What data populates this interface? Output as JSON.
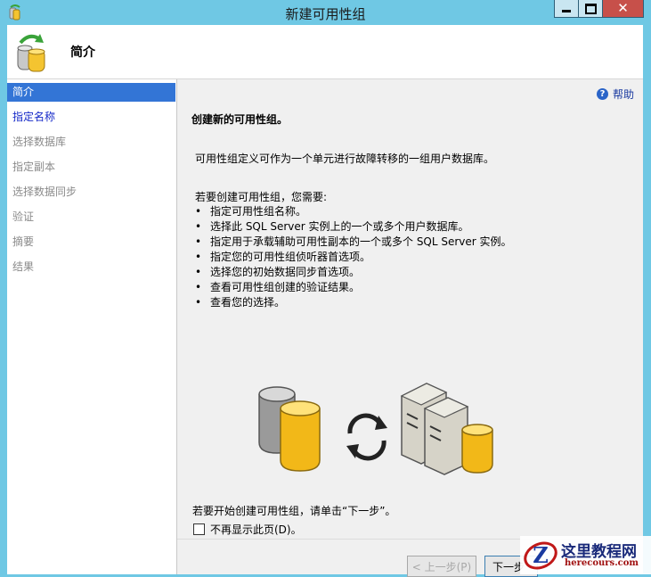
{
  "window": {
    "title": "新建可用性组"
  },
  "header": {
    "title": "简介"
  },
  "nav": {
    "items": [
      {
        "label": "简介",
        "state": "active"
      },
      {
        "label": "指定名称",
        "state": "link"
      },
      {
        "label": "选择数据库",
        "state": "disabled"
      },
      {
        "label": "指定副本",
        "state": "disabled"
      },
      {
        "label": "选择数据同步",
        "state": "disabled"
      },
      {
        "label": "验证",
        "state": "disabled"
      },
      {
        "label": "摘要",
        "state": "disabled"
      },
      {
        "label": "结果",
        "state": "disabled"
      }
    ]
  },
  "content": {
    "help_label": "帮助",
    "heading": "创建新的可用性组。",
    "description": "可用性组定义可作为一个单元进行故障转移的一组用户数据库。",
    "requirements_intro": "若要创建可用性组，您需要:",
    "requirements": [
      "指定可用性组名称。",
      "选择此 SQL Server 实例上的一个或多个用户数据库。",
      "指定用于承载辅助可用性副本的一个或多个 SQL Server 实例。",
      "指定您的可用性组侦听器首选项。",
      "选择您的初始数据同步首选项。",
      "查看可用性组创建的验证结果。",
      "查看您的选择。"
    ],
    "start_text": "若要开始创建可用性组，请单击“下一步”。",
    "dont_show_label": "不再显示此页(D)。",
    "dont_show_checked": false
  },
  "footer": {
    "prev_label": "< 上一步(P)",
    "next_label": "下一步"
  },
  "watermark": {
    "title": "这里教程网",
    "url": "herecours.com"
  },
  "colors": {
    "frame": "#6fc8e4",
    "nav_active": "#3375d6",
    "nav_link": "#1428c8",
    "close_button": "#c7504a"
  }
}
